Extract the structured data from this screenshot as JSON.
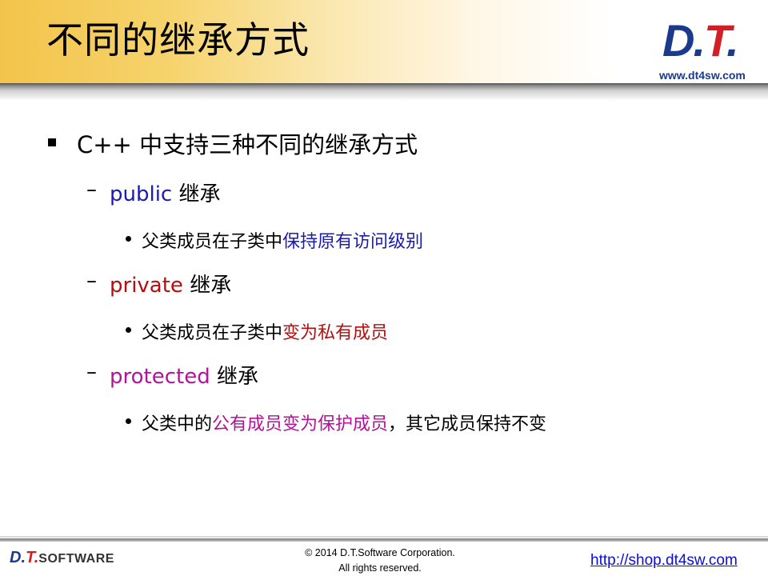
{
  "title": "不同的继承方式",
  "logo": {
    "d": "D",
    "t": "T",
    "url": "www.dt4sw.com"
  },
  "bullets": {
    "main": "C++ 中支持三种不同的继承方式",
    "public": {
      "keyword": "public",
      "suffix": " 继承",
      "desc_plain": "父类成员在子类中",
      "desc_highlight": "保持原有访问级别"
    },
    "private": {
      "keyword": "private",
      "suffix": " 继承",
      "desc_plain": "父类成员在子类中",
      "desc_highlight": "变为私有成员"
    },
    "protected": {
      "keyword": "protected",
      "suffix": " 继承",
      "desc_plain": "父类中的",
      "desc_highlight": "公有成员变为保护成员",
      "desc_tail": "，其它成员保持不变"
    }
  },
  "footer": {
    "logo_d": "D.",
    "logo_t": "T.",
    "logo_software": "SOFTWARE",
    "copyright_line1": "© 2014 D.T.Software Corporation.",
    "copyright_line2": "All rights reserved.",
    "shop_link": "http://shop.dt4sw.com"
  },
  "colors": {
    "public": "#1a1ab4",
    "private": "#b40e0e",
    "protected": "#b5129b",
    "brand_blue": "#1a3a8c",
    "brand_red": "#d21f26"
  }
}
